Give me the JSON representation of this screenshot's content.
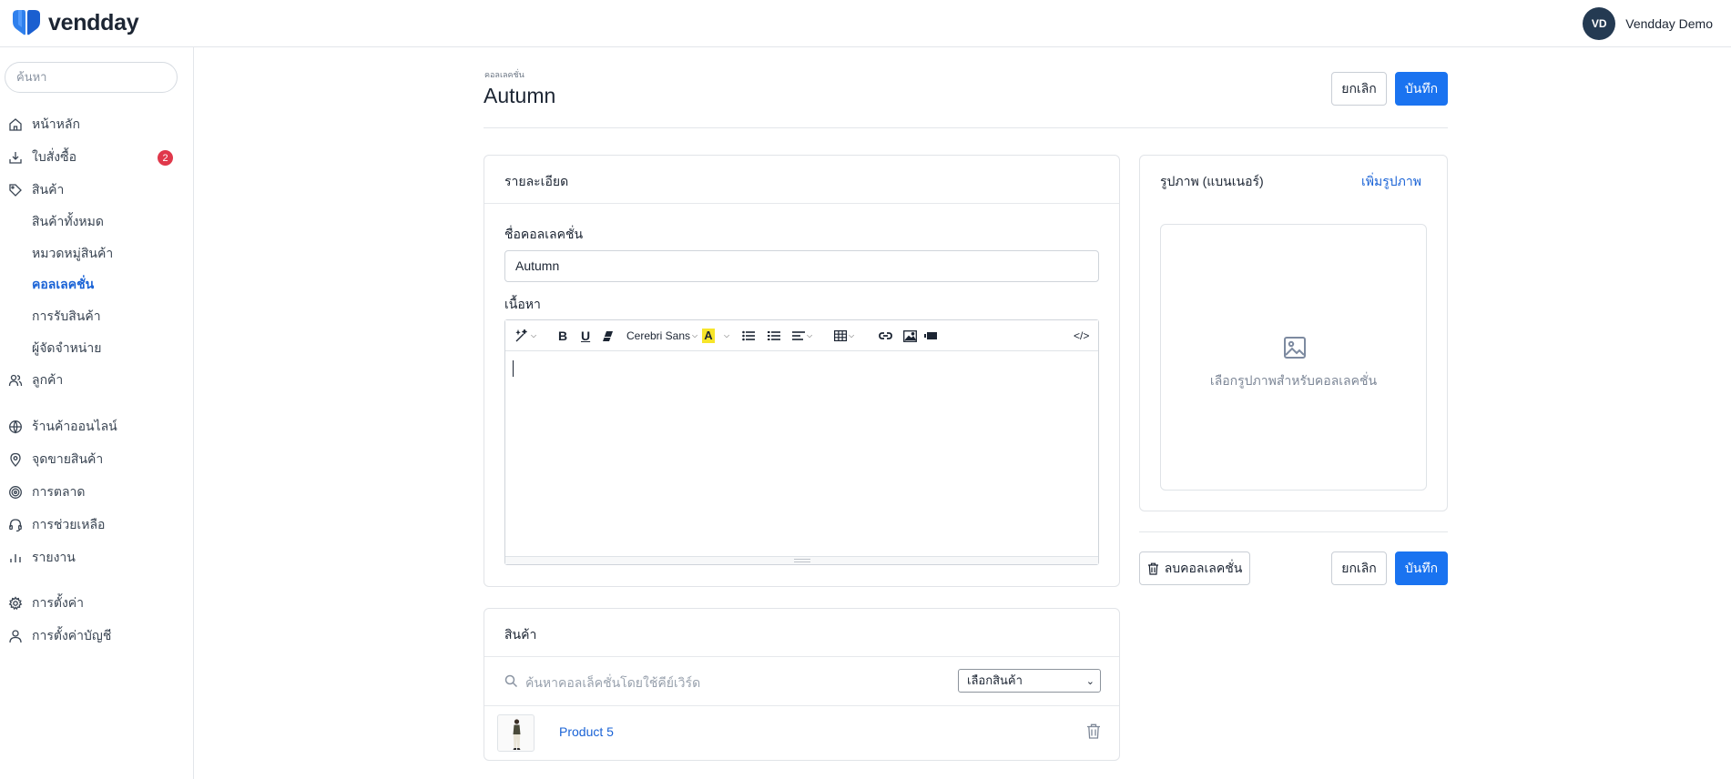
{
  "brand": {
    "name": "vendday"
  },
  "user": {
    "initials": "VD",
    "name": "Vendday Demo"
  },
  "sidebar": {
    "search_placeholder": "ค้นหา",
    "items": [
      {
        "label": "หน้าหลัก",
        "icon": "home-icon"
      },
      {
        "label": "ใบสั่งซื้อ",
        "icon": "download-icon",
        "badge": "2"
      },
      {
        "label": "สินค้า",
        "icon": "tag-icon"
      },
      {
        "label": "สินค้าทั้งหมด"
      },
      {
        "label": "หมวดหมู่สินค้า"
      },
      {
        "label": "คอลเลคชั่น",
        "active": true
      },
      {
        "label": "การรับสินค้า"
      },
      {
        "label": "ผู้จัดจำหน่าย"
      },
      {
        "label": "ลูกค้า",
        "icon": "users-icon"
      },
      {
        "label": "ร้านค้าออนไลน์",
        "icon": "globe-icon"
      },
      {
        "label": "จุดขายสินค้า",
        "icon": "location-pin-icon"
      },
      {
        "label": "การตลาด",
        "icon": "target-icon"
      },
      {
        "label": "การช่วยเหลือ",
        "icon": "headset-icon"
      },
      {
        "label": "รายงาน",
        "icon": "bar-chart-icon"
      },
      {
        "label": "การตั้งค่า",
        "icon": "gear-icon"
      },
      {
        "label": "การตั้งค่าบัญชี",
        "icon": "user-icon"
      }
    ]
  },
  "page": {
    "breadcrumb": "คอลเลคชั่น",
    "title": "Autumn",
    "cancel_label": "ยกเลิก",
    "save_label": "บันทึก"
  },
  "details": {
    "title": "รายละเอียด",
    "name_label": "ชื่อคอลเลคชั่น",
    "name_value": "Autumn",
    "content_label": "เนื้อหา",
    "font_name": "Cerebri Sans"
  },
  "image": {
    "title": "รูปภาพ (แบนเนอร์)",
    "add_label": "เพิ่มรูปภาพ",
    "placeholder": "เลือกรูปภาพสำหรับคอลเลคชั่น"
  },
  "actions": {
    "delete_label": "ลบคอลเลคชั่น",
    "cancel_label": "ยกเลิก",
    "save_label": "บันทึก"
  },
  "products": {
    "title": "สินค้า",
    "search_placeholder": "ค้นหาคอลเล็คชั่นโดยใช้คีย์เวิร์ด",
    "select_value": "เลือกสินค้า",
    "items": [
      {
        "name": "Product 5"
      }
    ]
  },
  "colors": {
    "primary": "#1a73f0",
    "link": "#1a63d6",
    "badge": "#e0384b",
    "avatar": "#243a52"
  }
}
